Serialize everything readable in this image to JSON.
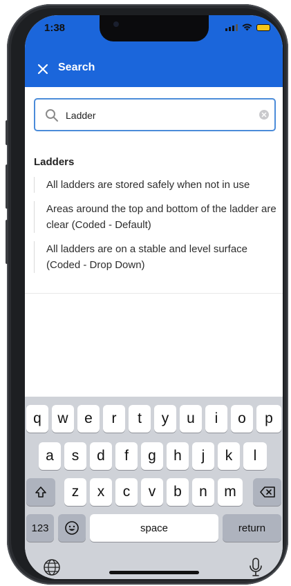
{
  "status_bar": {
    "time": "1:38"
  },
  "header": {
    "title": "Search",
    "close_icon": "close-icon"
  },
  "search": {
    "value": "Ladder",
    "placeholder": ""
  },
  "results": {
    "section_title": "Ladders",
    "items": [
      {
        "text": "All ladders are stored safely when not in use"
      },
      {
        "text": "Areas around the top and bottom of the ladder are clear (Coded - Default)"
      },
      {
        "text": "All ladders are on a stable and level surface (Coded - Drop Down)"
      }
    ]
  },
  "keyboard": {
    "row1": [
      "q",
      "w",
      "e",
      "r",
      "t",
      "y",
      "u",
      "i",
      "o",
      "p"
    ],
    "row2": [
      "a",
      "s",
      "d",
      "f",
      "g",
      "h",
      "j",
      "k",
      "l"
    ],
    "row3": [
      "z",
      "x",
      "c",
      "v",
      "b",
      "n",
      "m"
    ],
    "numbers_label": "123",
    "space_label": "space",
    "return_label": "return"
  },
  "colors": {
    "accent": "#1b66db",
    "battery": "#f5c518"
  }
}
